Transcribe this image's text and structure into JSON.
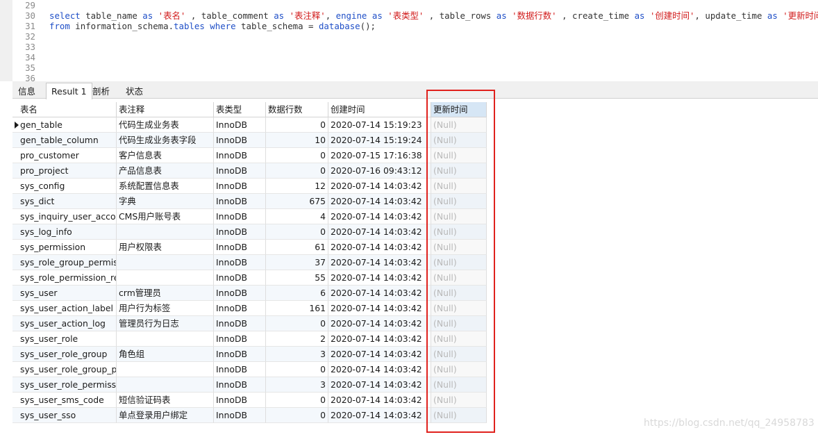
{
  "editor": {
    "lines": [
      {
        "num": "29",
        "tokens": []
      },
      {
        "num": "30",
        "tokens": [
          {
            "t": "select",
            "c": "kw"
          },
          {
            "t": " table_name ",
            "c": "plain"
          },
          {
            "t": "as",
            "c": "kw"
          },
          {
            "t": " '表名'",
            "c": "str"
          },
          {
            "t": " , table_comment ",
            "c": "plain"
          },
          {
            "t": "as",
            "c": "kw"
          },
          {
            "t": " '表注释'",
            "c": "str"
          },
          {
            "t": ", ",
            "c": "plain"
          },
          {
            "t": "engine",
            "c": "kw"
          },
          {
            "t": " ",
            "c": "plain"
          },
          {
            "t": "as",
            "c": "kw"
          },
          {
            "t": " '表类型'",
            "c": "str"
          },
          {
            "t": " , table_rows ",
            "c": "plain"
          },
          {
            "t": "as",
            "c": "kw"
          },
          {
            "t": " '数据行数'",
            "c": "str"
          },
          {
            "t": " , create_time ",
            "c": "plain"
          },
          {
            "t": "as",
            "c": "kw"
          },
          {
            "t": " '创建时间'",
            "c": "str"
          },
          {
            "t": ", update_time ",
            "c": "plain"
          },
          {
            "t": "as",
            "c": "kw"
          },
          {
            "t": " '更新时间'",
            "c": "str"
          }
        ]
      },
      {
        "num": "31",
        "tokens": [
          {
            "t": "from",
            "c": "kw"
          },
          {
            "t": " information_schema.",
            "c": "plain"
          },
          {
            "t": "tables",
            "c": "kw"
          },
          {
            "t": " ",
            "c": "plain"
          },
          {
            "t": "where",
            "c": "kw"
          },
          {
            "t": " table_schema = ",
            "c": "plain"
          },
          {
            "t": "database",
            "c": "kw"
          },
          {
            "t": "();",
            "c": "plain"
          }
        ]
      },
      {
        "num": "32",
        "tokens": []
      },
      {
        "num": "33",
        "tokens": []
      },
      {
        "num": "34",
        "tokens": []
      },
      {
        "num": "35",
        "tokens": []
      },
      {
        "num": "36",
        "tokens": []
      }
    ]
  },
  "tabs": [
    {
      "label": "信息",
      "active": false
    },
    {
      "label": "Result 1",
      "active": true
    },
    {
      "label": "剖析",
      "active": false
    },
    {
      "label": "状态",
      "active": false
    }
  ],
  "table": {
    "columns": [
      "表名",
      "表注释",
      "表类型",
      "数据行数",
      "创建时间",
      "更新时间"
    ],
    "selected_column": 5,
    "current_row": 0,
    "rows": [
      [
        "gen_table",
        "代码生成业务表",
        "InnoDB",
        "0",
        "2020-07-14 15:19:23",
        "(Null)"
      ],
      [
        "gen_table_column",
        "代码生成业务表字段",
        "InnoDB",
        "10",
        "2020-07-14 15:19:24",
        "(Null)"
      ],
      [
        "pro_customer",
        "客户信息表",
        "InnoDB",
        "0",
        "2020-07-15 17:16:38",
        "(Null)"
      ],
      [
        "pro_project",
        "产品信息表",
        "InnoDB",
        "0",
        "2020-07-16 09:43:12",
        "(Null)"
      ],
      [
        "sys_config",
        "系统配置信息表",
        "InnoDB",
        "12",
        "2020-07-14 14:03:42",
        "(Null)"
      ],
      [
        "sys_dict",
        "字典",
        "InnoDB",
        "675",
        "2020-07-14 14:03:42",
        "(Null)"
      ],
      [
        "sys_inquiry_user_account",
        "CMS用户账号表",
        "InnoDB",
        "4",
        "2020-07-14 14:03:42",
        "(Null)"
      ],
      [
        "sys_log_info",
        "",
        "InnoDB",
        "0",
        "2020-07-14 14:03:42",
        "(Null)"
      ],
      [
        "sys_permission",
        "用户权限表",
        "InnoDB",
        "61",
        "2020-07-14 14:03:42",
        "(Null)"
      ],
      [
        "sys_role_group_permissio",
        "",
        "InnoDB",
        "37",
        "2020-07-14 14:03:42",
        "(Null)"
      ],
      [
        "sys_role_permission_rel",
        "",
        "InnoDB",
        "55",
        "2020-07-14 14:03:42",
        "(Null)"
      ],
      [
        "sys_user",
        "crm管理员",
        "InnoDB",
        "6",
        "2020-07-14 14:03:42",
        "(Null)"
      ],
      [
        "sys_user_action_label",
        "用户行为标签",
        "InnoDB",
        "161",
        "2020-07-14 14:03:42",
        "(Null)"
      ],
      [
        "sys_user_action_log",
        "管理员行为日志",
        "InnoDB",
        "0",
        "2020-07-14 14:03:42",
        "(Null)"
      ],
      [
        "sys_user_role",
        "",
        "InnoDB",
        "2",
        "2020-07-14 14:03:42",
        "(Null)"
      ],
      [
        "sys_user_role_group",
        "角色组",
        "InnoDB",
        "3",
        "2020-07-14 14:03:42",
        "(Null)"
      ],
      [
        "sys_user_role_group_pern",
        "",
        "InnoDB",
        "0",
        "2020-07-14 14:03:42",
        "(Null)"
      ],
      [
        "sys_user_role_permission_",
        "",
        "InnoDB",
        "3",
        "2020-07-14 14:03:42",
        "(Null)"
      ],
      [
        "sys_user_sms_code",
        "短信验证码表",
        "InnoDB",
        "0",
        "2020-07-14 14:03:42",
        "(Null)"
      ],
      [
        "sys_user_sso",
        "单点登录用户绑定",
        "InnoDB",
        "0",
        "2020-07-14 14:03:42",
        "(Null)"
      ]
    ]
  },
  "annotation": {
    "color": "#e0211d",
    "target": "更新时间"
  },
  "watermark": "https://blog.csdn.net/qq_24958783",
  "colors": {
    "keyword": "#1f4fc7",
    "string": "#d11a1a",
    "selected_header": "#d6e6f5",
    "null_text": "#b8b8b8"
  }
}
